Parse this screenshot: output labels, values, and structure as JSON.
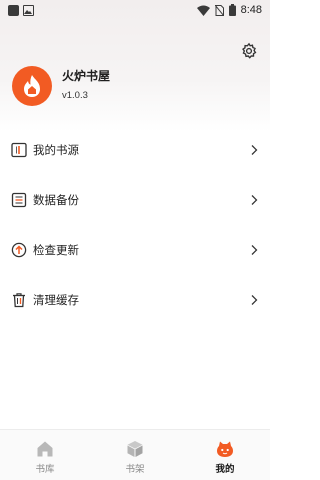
{
  "status_bar": {
    "time": "8:48"
  },
  "profile": {
    "name": "火炉书屋",
    "version": "v1.0.3"
  },
  "menu": {
    "items": [
      {
        "label": "我的书源",
        "icon": "book-source-icon"
      },
      {
        "label": "数据备份",
        "icon": "backup-icon"
      },
      {
        "label": "检查更新",
        "icon": "update-icon"
      },
      {
        "label": "清理缓存",
        "icon": "trash-icon"
      }
    ]
  },
  "bottom_nav": {
    "tabs": [
      {
        "label": "书库",
        "icon": "home-icon",
        "active": false
      },
      {
        "label": "书架",
        "icon": "box-icon",
        "active": false
      },
      {
        "label": "我的",
        "icon": "profile-face-icon",
        "active": true
      }
    ]
  },
  "colors": {
    "accent": "#f25b23",
    "text": "#1f1f1f",
    "inactive": "#8a8a8a"
  }
}
